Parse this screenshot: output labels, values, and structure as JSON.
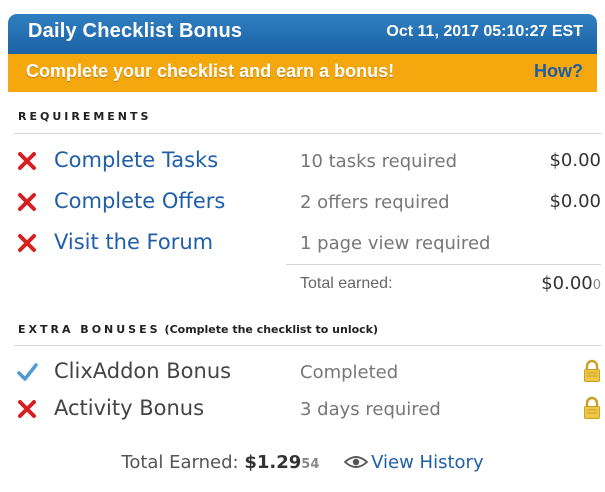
{
  "header": {
    "title": "Daily Checklist Bonus",
    "datetime": "Oct 11, 2017 05:10:27 EST"
  },
  "banner": {
    "message": "Complete your checklist and earn a bonus!",
    "how_link": "How?"
  },
  "requirements": {
    "label": "REQUIREMENTS",
    "items": [
      {
        "name": "Complete Tasks",
        "requirement": "10 tasks required",
        "amount": "$0.00",
        "status_icon": "x-icon"
      },
      {
        "name": "Complete Offers",
        "requirement": "2 offers required",
        "amount": "$0.00",
        "status_icon": "x-icon"
      },
      {
        "name": "Visit the Forum",
        "requirement": "1 page view required",
        "amount": "",
        "status_icon": "x-icon"
      }
    ],
    "total_label": "Total earned:",
    "total_value": "$0.00",
    "total_value_small": "0"
  },
  "extra_bonuses": {
    "label": "EXTRA BONUSES",
    "note": "(Complete the checklist to unlock)",
    "items": [
      {
        "name": "ClixAddon Bonus",
        "status": "Completed",
        "status_icon": "check-icon",
        "lock_icon": "lock-icon"
      },
      {
        "name": "Activity Bonus",
        "status": "3 days required",
        "status_icon": "x-icon",
        "lock_icon": "lock-icon"
      }
    ]
  },
  "footer": {
    "total_label": "Total Earned:",
    "total_value": "$1.29",
    "total_value_small": "54",
    "history_link": "View History",
    "history_icon": "eye-icon"
  },
  "colors": {
    "header_blue": "#1b62a4",
    "banner_orange": "#f5a80e",
    "link_blue": "#1f5ea8",
    "x_red": "#d62020",
    "check_blue": "#4f9ad6",
    "lock_gold": "#e6b820"
  }
}
